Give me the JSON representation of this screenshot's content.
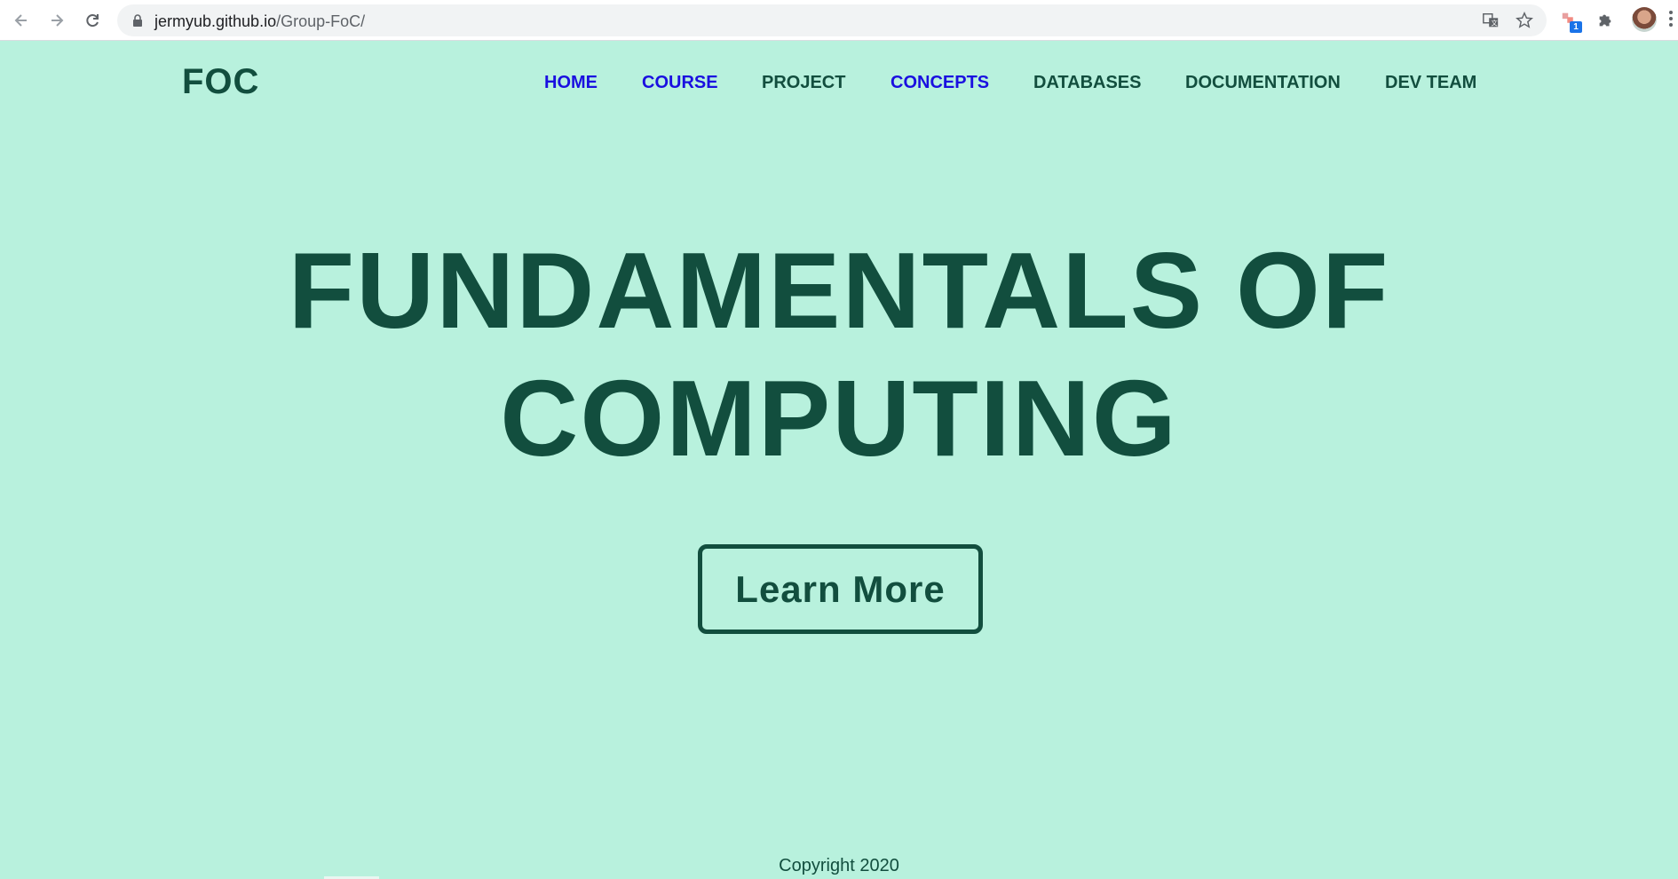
{
  "browser": {
    "url_domain": "jermyub.github.io",
    "url_path": "/Group-FoC/",
    "icons": [
      "back-icon",
      "forward-icon",
      "reload-icon",
      "lock-icon",
      "translate-icon",
      "star-icon",
      "extension-badge-icon",
      "puzzle-icon",
      "avatar",
      "menu-icon"
    ],
    "extension_badge": "1"
  },
  "site": {
    "logo": "FOC",
    "nav": [
      {
        "label": "HOME",
        "color": "#1a0fe0"
      },
      {
        "label": "COURSE",
        "color": "#1a0fe0"
      },
      {
        "label": "PROJECT",
        "color": "#124e3e"
      },
      {
        "label": "CONCEPTS",
        "color": "#1a0fe0"
      },
      {
        "label": "DATABASES",
        "color": "#124e3e"
      },
      {
        "label": "DOCUMENTATION",
        "color": "#124e3e"
      },
      {
        "label": "DEV TEAM",
        "color": "#124e3e"
      }
    ],
    "hero_line1": "FUNDAMENTALS OF",
    "hero_line2": "COMPUTING",
    "cta_label": "Learn More",
    "footer": "Copyright 2020"
  },
  "colors": {
    "background": "#b8f1dd",
    "primary": "#124e3e",
    "link_visited": "#1a0fe0"
  }
}
